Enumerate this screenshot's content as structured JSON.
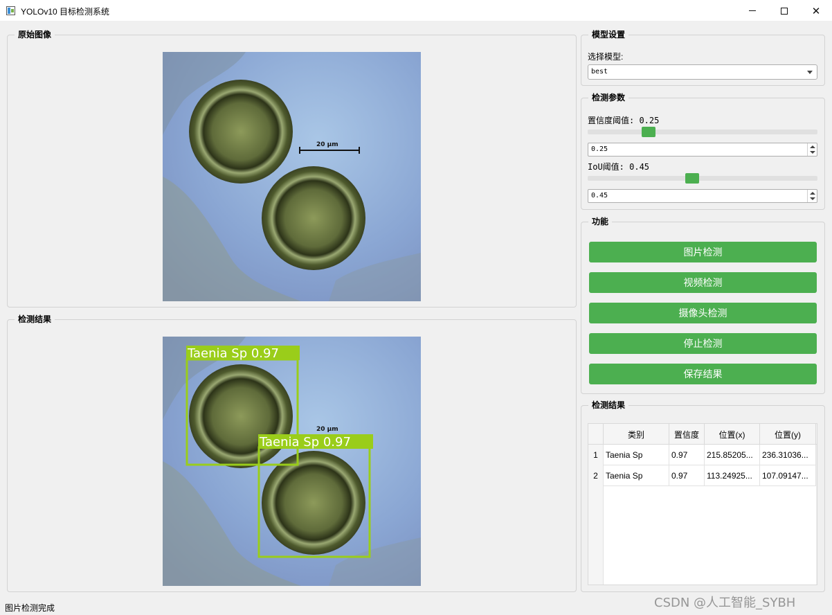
{
  "window": {
    "title": "YOLOv10 目标检测系统",
    "controls": [
      "minimize",
      "maximize",
      "close"
    ]
  },
  "panels": {
    "original_title": "原始图像",
    "result_title": "检测结果"
  },
  "result_image": {
    "detections_overlay": [
      {
        "label": "Taenia Sp 0.97",
        "color": "#9acd1a"
      },
      {
        "label": "Taenia Sp 0.97",
        "color": "#9acd1a"
      }
    ]
  },
  "model_settings": {
    "title": "模型设置",
    "select_label": "选择模型:",
    "selected_model": "best"
  },
  "detection_params": {
    "title": "检测参数",
    "confidence_label": "置信度阈值: 0.25",
    "confidence_value": "0.25",
    "confidence_level": 0.25,
    "iou_label": "IoU阈值: 0.45",
    "iou_value": "0.45",
    "iou_level": 0.45
  },
  "functions": {
    "title": "功能",
    "buttons": [
      "图片检测",
      "视频检测",
      "摄像头检测",
      "停止检测",
      "保存结果"
    ]
  },
  "results": {
    "title": "检测结果",
    "columns": [
      "类别",
      "置信度",
      "位置(x)",
      "位置(y)"
    ],
    "rows": [
      {
        "index": "1",
        "class": "Taenia Sp",
        "confidence": "0.97",
        "x": "215.85205...",
        "y": "236.31036..."
      },
      {
        "index": "2",
        "class": "Taenia Sp",
        "confidence": "0.97",
        "x": "113.24925...",
        "y": "107.09147..."
      }
    ]
  },
  "status": {
    "text": "图片检测完成"
  },
  "watermark": "CSDN @人工智能_SYBH",
  "colors": {
    "accent_green": "#4caf50",
    "box_green": "#9acd1a",
    "window_bg": "#f0f0f0"
  }
}
